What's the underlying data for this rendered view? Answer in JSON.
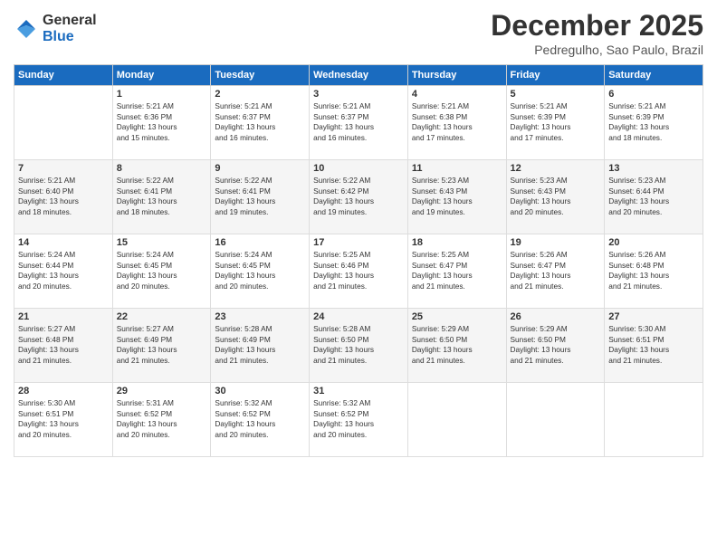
{
  "logo": {
    "general": "General",
    "blue": "Blue"
  },
  "title": "December 2025",
  "location": "Pedregulho, Sao Paulo, Brazil",
  "days_of_week": [
    "Sunday",
    "Monday",
    "Tuesday",
    "Wednesday",
    "Thursday",
    "Friday",
    "Saturday"
  ],
  "weeks": [
    [
      {
        "day": "",
        "info": ""
      },
      {
        "day": "1",
        "info": "Sunrise: 5:21 AM\nSunset: 6:36 PM\nDaylight: 13 hours\nand 15 minutes."
      },
      {
        "day": "2",
        "info": "Sunrise: 5:21 AM\nSunset: 6:37 PM\nDaylight: 13 hours\nand 16 minutes."
      },
      {
        "day": "3",
        "info": "Sunrise: 5:21 AM\nSunset: 6:37 PM\nDaylight: 13 hours\nand 16 minutes."
      },
      {
        "day": "4",
        "info": "Sunrise: 5:21 AM\nSunset: 6:38 PM\nDaylight: 13 hours\nand 17 minutes."
      },
      {
        "day": "5",
        "info": "Sunrise: 5:21 AM\nSunset: 6:39 PM\nDaylight: 13 hours\nand 17 minutes."
      },
      {
        "day": "6",
        "info": "Sunrise: 5:21 AM\nSunset: 6:39 PM\nDaylight: 13 hours\nand 18 minutes."
      }
    ],
    [
      {
        "day": "7",
        "info": "Sunrise: 5:21 AM\nSunset: 6:40 PM\nDaylight: 13 hours\nand 18 minutes."
      },
      {
        "day": "8",
        "info": "Sunrise: 5:22 AM\nSunset: 6:41 PM\nDaylight: 13 hours\nand 18 minutes."
      },
      {
        "day": "9",
        "info": "Sunrise: 5:22 AM\nSunset: 6:41 PM\nDaylight: 13 hours\nand 19 minutes."
      },
      {
        "day": "10",
        "info": "Sunrise: 5:22 AM\nSunset: 6:42 PM\nDaylight: 13 hours\nand 19 minutes."
      },
      {
        "day": "11",
        "info": "Sunrise: 5:23 AM\nSunset: 6:43 PM\nDaylight: 13 hours\nand 19 minutes."
      },
      {
        "day": "12",
        "info": "Sunrise: 5:23 AM\nSunset: 6:43 PM\nDaylight: 13 hours\nand 20 minutes."
      },
      {
        "day": "13",
        "info": "Sunrise: 5:23 AM\nSunset: 6:44 PM\nDaylight: 13 hours\nand 20 minutes."
      }
    ],
    [
      {
        "day": "14",
        "info": "Sunrise: 5:24 AM\nSunset: 6:44 PM\nDaylight: 13 hours\nand 20 minutes."
      },
      {
        "day": "15",
        "info": "Sunrise: 5:24 AM\nSunset: 6:45 PM\nDaylight: 13 hours\nand 20 minutes."
      },
      {
        "day": "16",
        "info": "Sunrise: 5:24 AM\nSunset: 6:45 PM\nDaylight: 13 hours\nand 20 minutes."
      },
      {
        "day": "17",
        "info": "Sunrise: 5:25 AM\nSunset: 6:46 PM\nDaylight: 13 hours\nand 21 minutes."
      },
      {
        "day": "18",
        "info": "Sunrise: 5:25 AM\nSunset: 6:47 PM\nDaylight: 13 hours\nand 21 minutes."
      },
      {
        "day": "19",
        "info": "Sunrise: 5:26 AM\nSunset: 6:47 PM\nDaylight: 13 hours\nand 21 minutes."
      },
      {
        "day": "20",
        "info": "Sunrise: 5:26 AM\nSunset: 6:48 PM\nDaylight: 13 hours\nand 21 minutes."
      }
    ],
    [
      {
        "day": "21",
        "info": "Sunrise: 5:27 AM\nSunset: 6:48 PM\nDaylight: 13 hours\nand 21 minutes."
      },
      {
        "day": "22",
        "info": "Sunrise: 5:27 AM\nSunset: 6:49 PM\nDaylight: 13 hours\nand 21 minutes."
      },
      {
        "day": "23",
        "info": "Sunrise: 5:28 AM\nSunset: 6:49 PM\nDaylight: 13 hours\nand 21 minutes."
      },
      {
        "day": "24",
        "info": "Sunrise: 5:28 AM\nSunset: 6:50 PM\nDaylight: 13 hours\nand 21 minutes."
      },
      {
        "day": "25",
        "info": "Sunrise: 5:29 AM\nSunset: 6:50 PM\nDaylight: 13 hours\nand 21 minutes."
      },
      {
        "day": "26",
        "info": "Sunrise: 5:29 AM\nSunset: 6:50 PM\nDaylight: 13 hours\nand 21 minutes."
      },
      {
        "day": "27",
        "info": "Sunrise: 5:30 AM\nSunset: 6:51 PM\nDaylight: 13 hours\nand 21 minutes."
      }
    ],
    [
      {
        "day": "28",
        "info": "Sunrise: 5:30 AM\nSunset: 6:51 PM\nDaylight: 13 hours\nand 20 minutes."
      },
      {
        "day": "29",
        "info": "Sunrise: 5:31 AM\nSunset: 6:52 PM\nDaylight: 13 hours\nand 20 minutes."
      },
      {
        "day": "30",
        "info": "Sunrise: 5:32 AM\nSunset: 6:52 PM\nDaylight: 13 hours\nand 20 minutes."
      },
      {
        "day": "31",
        "info": "Sunrise: 5:32 AM\nSunset: 6:52 PM\nDaylight: 13 hours\nand 20 minutes."
      },
      {
        "day": "",
        "info": ""
      },
      {
        "day": "",
        "info": ""
      },
      {
        "day": "",
        "info": ""
      }
    ]
  ]
}
